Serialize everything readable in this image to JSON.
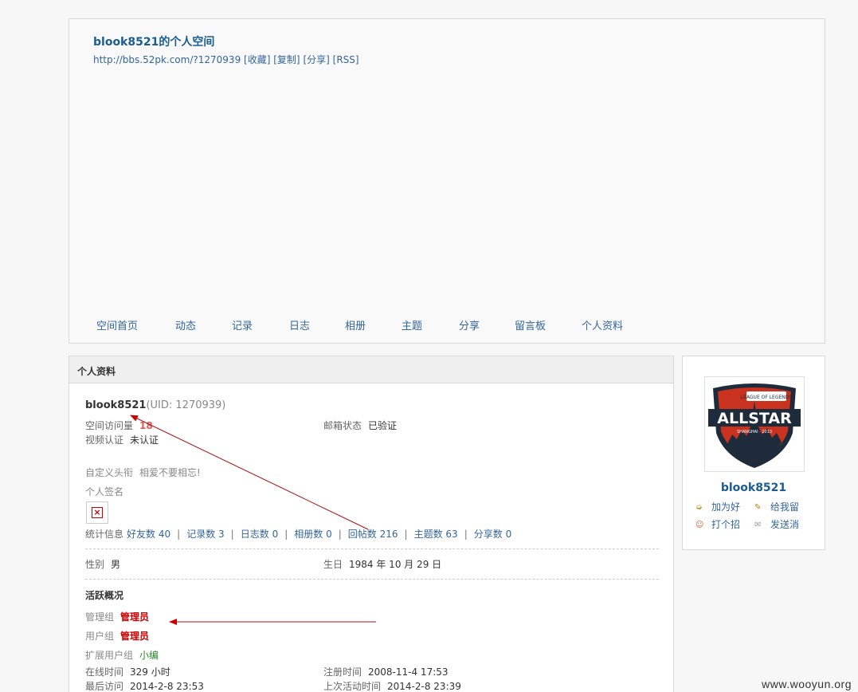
{
  "header": {
    "title": "blook8521的个人空间",
    "url": "http://bbs.52pk.com/?1270939",
    "links": [
      "[收藏]",
      "[复制]",
      "[分享]",
      "[RSS]"
    ]
  },
  "nav": [
    "空间首页",
    "动态",
    "记录",
    "日志",
    "相册",
    "主题",
    "分享",
    "留言板",
    "个人资料"
  ],
  "profile": {
    "heading": "个人资料",
    "username": "blook8521",
    "uid": "(UID: 1270939)",
    "visits_label": "空间访问量",
    "visits_value": "18",
    "email_label": "邮箱状态",
    "email_value": "已验证",
    "video_label": "视频认证",
    "video_value": "未认证",
    "custom_title_label": "自定义头衔",
    "custom_title_value": "相爱不要相忘!",
    "signature_label": "个人签名",
    "stats_label": "统计信息",
    "stats": [
      {
        "label": "好友数",
        "value": "40"
      },
      {
        "label": "记录数",
        "value": "3"
      },
      {
        "label": "日志数",
        "value": "0"
      },
      {
        "label": "相册数",
        "value": "0"
      },
      {
        "label": "回帖数",
        "value": "216"
      },
      {
        "label": "主题数",
        "value": "63"
      },
      {
        "label": "分享数",
        "value": "0"
      }
    ],
    "stats_sep": "|",
    "gender_label": "性别",
    "gender_value": "男",
    "birthday_label": "生日",
    "birthday_value": "1984 年 10 月 29 日",
    "activity_heading": "活跃概况",
    "admin_group_label": "管理组",
    "admin_group_value": "管理员",
    "user_group_label": "用户组",
    "user_group_value": "管理员",
    "ext_group_label": "扩展用户组",
    "ext_group_value": "小编",
    "online_label": "在线时间",
    "online_value": "329 小时",
    "register_label": "注册时间",
    "register_value": "2008-11-4 17:53",
    "last_visit_label": "最后访问",
    "last_visit_value": "2014-2-8 23:53",
    "last_active_label": "上次活动时间",
    "last_active_value": "2014-2-8 23:39"
  },
  "sidebar": {
    "name": "blook8521",
    "actions": [
      "加为好",
      "给我留",
      "打个招",
      "发送消"
    ],
    "avatar_logo_text": "ALLSTAR",
    "avatar_sub_text": "SHANGHAI · 2013",
    "avatar_top_text": "LEAGUE OF LEGENDS"
  },
  "watermark": "www.wooyun.org",
  "colors": {
    "link": "#336699",
    "title": "#1a5d8f",
    "red": "#cc0000",
    "green": "#2a8a2a"
  }
}
